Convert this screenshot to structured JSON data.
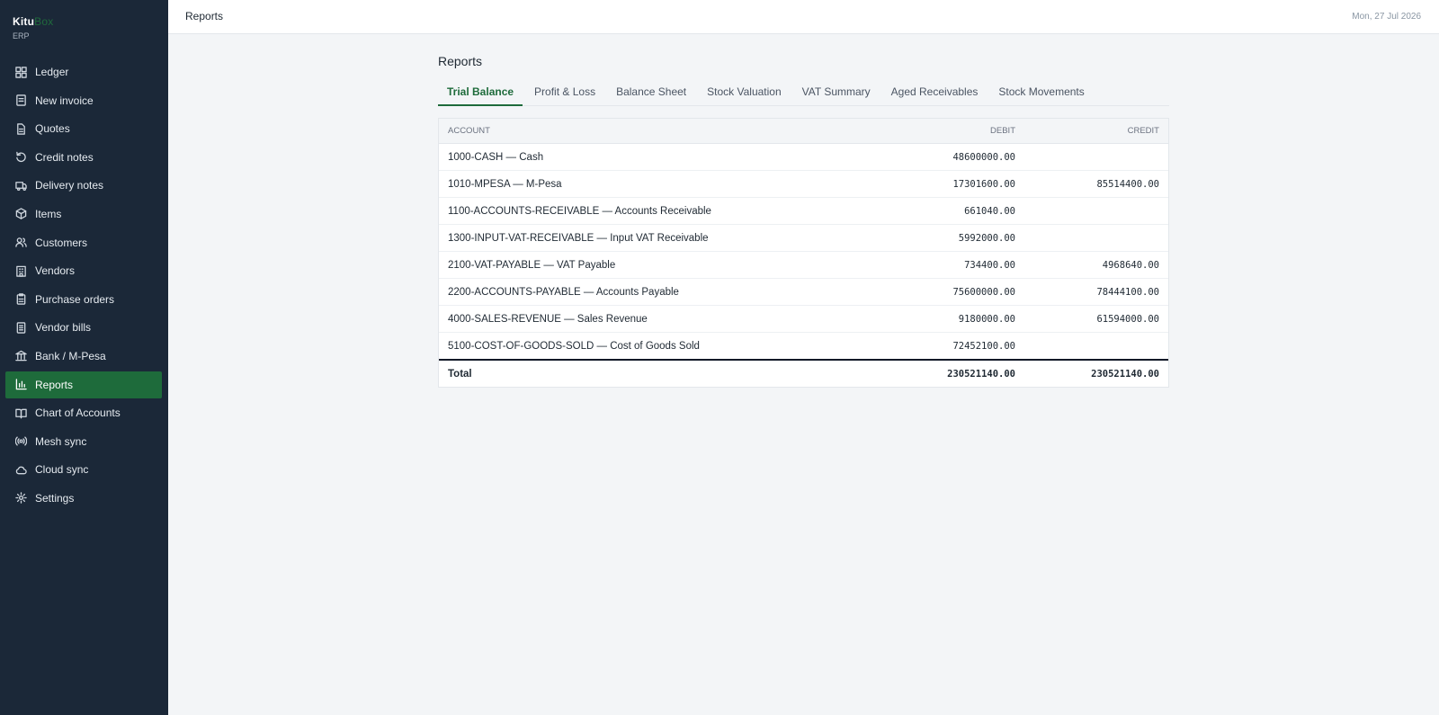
{
  "brand": {
    "name_primary": "Kitu",
    "name_accent": "Box",
    "subtitle": "ERP"
  },
  "sidebar": {
    "items": [
      {
        "label": "Ledger",
        "icon": "grid-icon"
      },
      {
        "label": "New invoice",
        "icon": "file-plus-icon"
      },
      {
        "label": "Quotes",
        "icon": "file-text-icon"
      },
      {
        "label": "Credit notes",
        "icon": "rotate-ccw-icon"
      },
      {
        "label": "Delivery notes",
        "icon": "truck-icon"
      },
      {
        "label": "Items",
        "icon": "package-icon"
      },
      {
        "label": "Customers",
        "icon": "users-icon"
      },
      {
        "label": "Vendors",
        "icon": "building-icon"
      },
      {
        "label": "Purchase orders",
        "icon": "clipboard-icon"
      },
      {
        "label": "Vendor bills",
        "icon": "receipt-icon"
      },
      {
        "label": "Bank / M-Pesa",
        "icon": "bank-icon"
      },
      {
        "label": "Reports",
        "icon": "bar-chart-icon",
        "active": true
      },
      {
        "label": "Chart of Accounts",
        "icon": "book-open-icon"
      },
      {
        "label": "Mesh sync",
        "icon": "radio-icon"
      },
      {
        "label": "Cloud sync",
        "icon": "cloud-icon"
      },
      {
        "label": "Settings",
        "icon": "gear-icon"
      }
    ]
  },
  "topbar": {
    "title": "Reports",
    "date": "Mon, 27 Jul 2026"
  },
  "main": {
    "title": "Reports",
    "tabs": [
      {
        "label": "Trial Balance",
        "active": true
      },
      {
        "label": "Profit & Loss"
      },
      {
        "label": "Balance Sheet"
      },
      {
        "label": "Stock Valuation"
      },
      {
        "label": "VAT Summary"
      },
      {
        "label": "Aged Receivables"
      },
      {
        "label": "Stock Movements"
      }
    ]
  },
  "table": {
    "headers": {
      "account": "ACCOUNT",
      "debit": "DEBIT",
      "credit": "CREDIT"
    },
    "rows": [
      {
        "account": "1000-CASH — Cash",
        "debit": "48600000.00",
        "credit": ""
      },
      {
        "account": "1010-MPESA — M-Pesa",
        "debit": "17301600.00",
        "credit": "85514400.00"
      },
      {
        "account": "1100-ACCOUNTS-RECEIVABLE — Accounts Receivable",
        "debit": "661040.00",
        "credit": ""
      },
      {
        "account": "1300-INPUT-VAT-RECEIVABLE — Input VAT Receivable",
        "debit": "5992000.00",
        "credit": ""
      },
      {
        "account": "2100-VAT-PAYABLE — VAT Payable",
        "debit": "734400.00",
        "credit": "4968640.00"
      },
      {
        "account": "2200-ACCOUNTS-PAYABLE — Accounts Payable",
        "debit": "75600000.00",
        "credit": "78444100.00"
      },
      {
        "account": "4000-SALES-REVENUE — Sales Revenue",
        "debit": "9180000.00",
        "credit": "61594000.00"
      },
      {
        "account": "5100-COST-OF-GOODS-SOLD — Cost of Goods Sold",
        "debit": "72452100.00",
        "credit": ""
      }
    ],
    "total": {
      "label": "Total",
      "debit": "230521140.00",
      "credit": "230521140.00"
    }
  },
  "colors": {
    "sidebar_bg": "#1b2838",
    "accent": "#1e6b3b",
    "page_bg": "#f3f5f7"
  }
}
